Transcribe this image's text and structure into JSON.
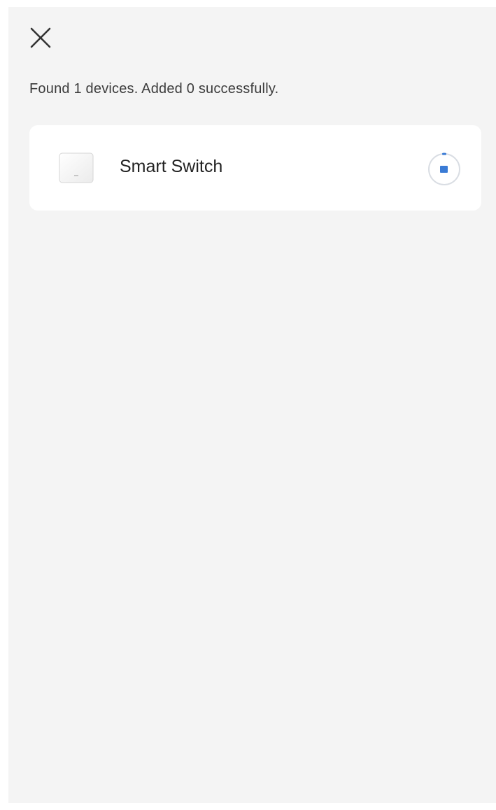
{
  "header": {
    "close_icon": "close-icon"
  },
  "status": {
    "message": "Found 1 devices. Added 0 successfully."
  },
  "devices": [
    {
      "name": "Smart Switch",
      "thumbnail_icon": "switch-device-icon",
      "state_icon": "progress-stop-icon"
    }
  ],
  "colors": {
    "background": "#f4f4f4",
    "card": "#ffffff",
    "accent": "#3a7bd5",
    "text_primary": "#222222",
    "text_secondary": "#3c3c3c"
  }
}
